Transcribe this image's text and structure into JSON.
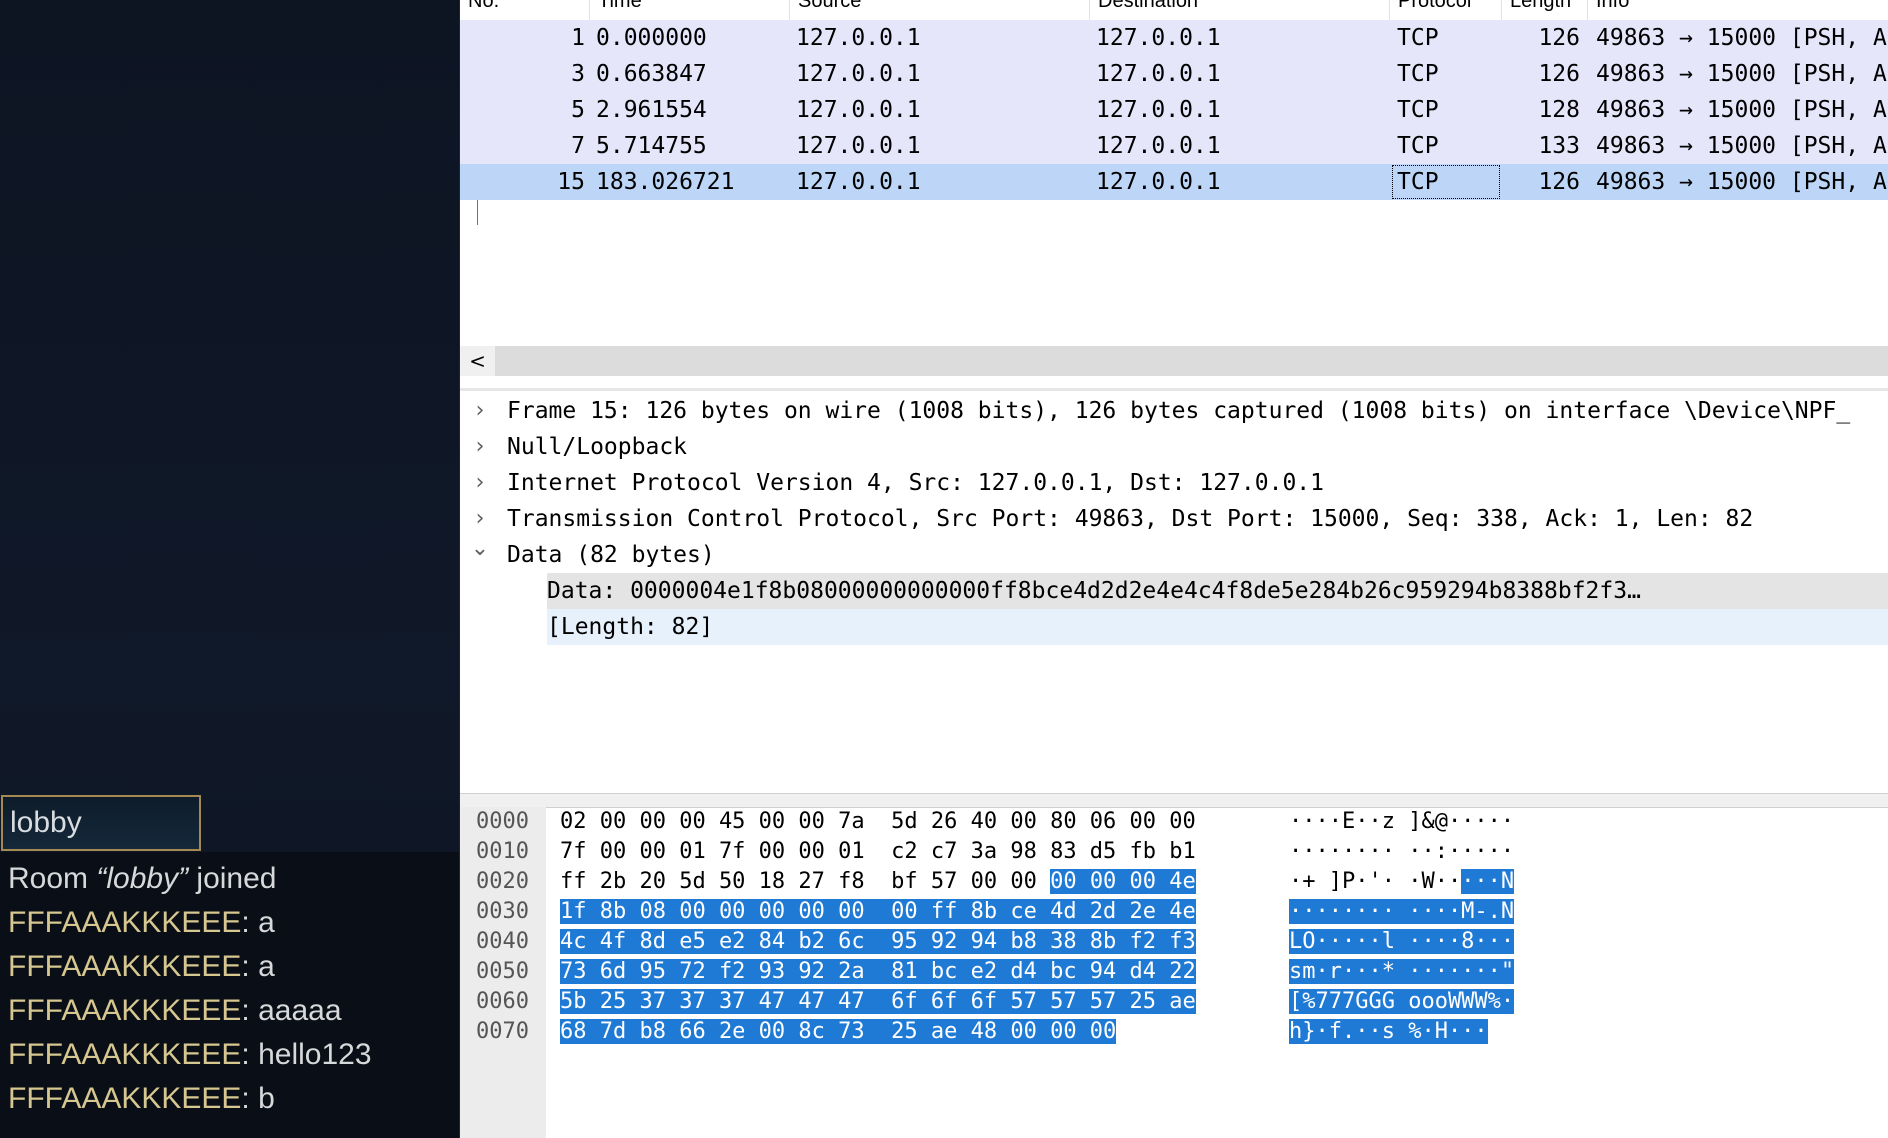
{
  "game": {
    "room_input_value": "lobby",
    "chat": [
      {
        "pre": "Room ",
        "q": "“lobby”",
        "post": " joined"
      },
      {
        "nick": "FFFAAAKKKEEE",
        "msg": ": a"
      },
      {
        "nick": "FFFAAAKKKEEE",
        "msg": ": a"
      },
      {
        "nick": "FFFAAAKKKEEE",
        "msg": ": aaaaa"
      },
      {
        "nick": "FFFAAAKKKEEE",
        "msg": ": hello123"
      },
      {
        "nick": "FFFAAAKKKEEE",
        "msg": ": b"
      }
    ]
  },
  "wireshark": {
    "columns": [
      "No.",
      "Time",
      "Source",
      "Destination",
      "Protocol",
      "Length",
      "Info"
    ],
    "packets": [
      {
        "no": "1",
        "time": "0.000000",
        "src": "127.0.0.1",
        "dst": "127.0.0.1",
        "proto": "TCP",
        "len": "126",
        "info": "49863 → 15000 [PSH, A"
      },
      {
        "no": "3",
        "time": "0.663847",
        "src": "127.0.0.1",
        "dst": "127.0.0.1",
        "proto": "TCP",
        "len": "126",
        "info": "49863 → 15000 [PSH, A"
      },
      {
        "no": "5",
        "time": "2.961554",
        "src": "127.0.0.1",
        "dst": "127.0.0.1",
        "proto": "TCP",
        "len": "128",
        "info": "49863 → 15000 [PSH, A"
      },
      {
        "no": "7",
        "time": "5.714755",
        "src": "127.0.0.1",
        "dst": "127.0.0.1",
        "proto": "TCP",
        "len": "133",
        "info": "49863 → 15000 [PSH, A"
      },
      {
        "no": "15",
        "time": "183.026721",
        "src": "127.0.0.1",
        "dst": "127.0.0.1",
        "proto": "TCP",
        "len": "126",
        "info": "49863 → 15000 [PSH, A"
      }
    ],
    "selected_index": 4,
    "details": [
      {
        "arrow": "›",
        "text": "Frame 15: 126 bytes on wire (1008 bits), 126 bytes captured (1008 bits) on interface \\Device\\NPF_"
      },
      {
        "arrow": "›",
        "text": "Null/Loopback"
      },
      {
        "arrow": "›",
        "text": "Internet Protocol Version 4, Src: 127.0.0.1, Dst: 127.0.0.1"
      },
      {
        "arrow": "›",
        "text": "Transmission Control Protocol, Src Port: 49863, Dst Port: 15000, Seq: 338, Ack: 1, Len: 82"
      },
      {
        "arrow": "⌄",
        "text": "Data (82 bytes)"
      }
    ],
    "data_children": [
      "Data: 0000004e1f8b08000000000000ff8bce4d2d2e4e4c4f8de5e284b26c959294b8388bf2f3…",
      "[Length: 82]"
    ],
    "scroll_left": "<",
    "bytes": [
      {
        "offset": "0000",
        "hex_plain": "02 00 00 00 45 00 00 7a  5d 26 40 00 80 06 00 00",
        "hex_sel": "",
        "asc_plain": "····E··z ]&@·····",
        "asc_sel": ""
      },
      {
        "offset": "0010",
        "hex_plain": "7f 00 00 01 7f 00 00 01  c2 c7 3a 98 83 d5 fb b1",
        "hex_sel": "",
        "asc_plain": "········ ··:·····",
        "asc_sel": ""
      },
      {
        "offset": "0020",
        "hex_plain": "ff 2b 20 5d 50 18 27 f8  bf 57 00 00 ",
        "hex_sel": "00 00 00 4e",
        "asc_plain": "·+ ]P·'· ·W··",
        "asc_sel": "···N"
      },
      {
        "offset": "0030",
        "hex_plain": "",
        "hex_sel": "1f 8b 08 00 00 00 00 00  00 ff 8b ce 4d 2d 2e 4e",
        "asc_plain": "",
        "asc_sel": "········ ····M-.N"
      },
      {
        "offset": "0040",
        "hex_plain": "",
        "hex_sel": "4c 4f 8d e5 e2 84 b2 6c  95 92 94 b8 38 8b f2 f3",
        "asc_plain": "",
        "asc_sel": "LO·····l ····8···"
      },
      {
        "offset": "0050",
        "hex_plain": "",
        "hex_sel": "73 6d 95 72 f2 93 92 2a  81 bc e2 d4 bc 94 d4 22",
        "asc_plain": "",
        "asc_sel": "sm·r···* ·······\""
      },
      {
        "offset": "0060",
        "hex_plain": "",
        "hex_sel": "5b 25 37 37 37 47 47 47  6f 6f 6f 57 57 57 25 ae",
        "asc_plain": "",
        "asc_sel": "[%777GGG oooWWW%·"
      },
      {
        "offset": "0070",
        "hex_plain": "",
        "hex_sel": "68 7d b8 66 2e 00 8c 73  25 ae 48 00 00 00",
        "asc_plain": "",
        "asc_sel": "h}·f.··s %·H···"
      }
    ]
  }
}
